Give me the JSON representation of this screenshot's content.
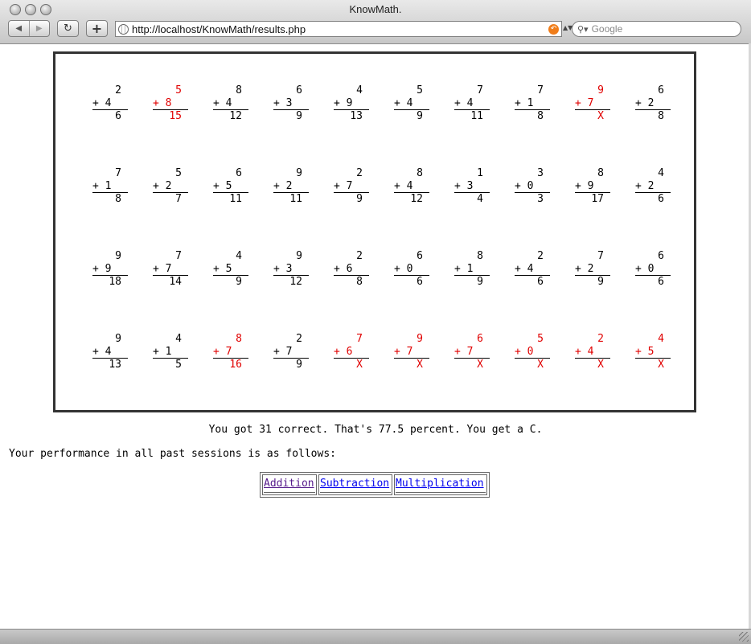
{
  "window": {
    "title": "KnowMath."
  },
  "toolbar": {
    "back_glyph": "◀",
    "forward_glyph": "▶",
    "reload_glyph": "↻",
    "add_glyph": "+",
    "url": "http://localhost/KnowMath/results.php",
    "search_placeholder": "Google",
    "rss_glyph": "↶",
    "dropdown_glyph": "▲▼",
    "search_glyph": "⚲▾"
  },
  "problems": [
    {
      "a": "2",
      "b": "+ 4",
      "ans": "6",
      "wrong": false
    },
    {
      "a": "5",
      "b": "+ 8",
      "ans": "15",
      "wrong": true
    },
    {
      "a": "8",
      "b": "+ 4",
      "ans": "12",
      "wrong": false
    },
    {
      "a": "6",
      "b": "+ 3",
      "ans": "9",
      "wrong": false
    },
    {
      "a": "4",
      "b": "+ 9",
      "ans": "13",
      "wrong": false
    },
    {
      "a": "5",
      "b": "+ 4",
      "ans": "9",
      "wrong": false
    },
    {
      "a": "7",
      "b": "+ 4",
      "ans": "11",
      "wrong": false
    },
    {
      "a": "7",
      "b": "+ 1",
      "ans": "8",
      "wrong": false
    },
    {
      "a": "9",
      "b": "+ 7",
      "ans": "X",
      "wrong": true
    },
    {
      "a": "6",
      "b": "+ 2",
      "ans": "8",
      "wrong": false
    },
    {
      "a": "7",
      "b": "+ 1",
      "ans": "8",
      "wrong": false
    },
    {
      "a": "5",
      "b": "+ 2",
      "ans": "7",
      "wrong": false
    },
    {
      "a": "6",
      "b": "+ 5",
      "ans": "11",
      "wrong": false
    },
    {
      "a": "9",
      "b": "+ 2",
      "ans": "11",
      "wrong": false
    },
    {
      "a": "2",
      "b": "+ 7",
      "ans": "9",
      "wrong": false
    },
    {
      "a": "8",
      "b": "+ 4",
      "ans": "12",
      "wrong": false
    },
    {
      "a": "1",
      "b": "+ 3",
      "ans": "4",
      "wrong": false
    },
    {
      "a": "3",
      "b": "+ 0",
      "ans": "3",
      "wrong": false
    },
    {
      "a": "8",
      "b": "+ 9",
      "ans": "17",
      "wrong": false
    },
    {
      "a": "4",
      "b": "+ 2",
      "ans": "6",
      "wrong": false
    },
    {
      "a": "9",
      "b": "+ 9",
      "ans": "18",
      "wrong": false
    },
    {
      "a": "7",
      "b": "+ 7",
      "ans": "14",
      "wrong": false
    },
    {
      "a": "4",
      "b": "+ 5",
      "ans": "9",
      "wrong": false
    },
    {
      "a": "9",
      "b": "+ 3",
      "ans": "12",
      "wrong": false
    },
    {
      "a": "2",
      "b": "+ 6",
      "ans": "8",
      "wrong": false
    },
    {
      "a": "6",
      "b": "+ 0",
      "ans": "6",
      "wrong": false
    },
    {
      "a": "8",
      "b": "+ 1",
      "ans": "9",
      "wrong": false
    },
    {
      "a": "2",
      "b": "+ 4",
      "ans": "6",
      "wrong": false
    },
    {
      "a": "7",
      "b": "+ 2",
      "ans": "9",
      "wrong": false
    },
    {
      "a": "6",
      "b": "+ 0",
      "ans": "6",
      "wrong": false
    },
    {
      "a": "9",
      "b": "+ 4",
      "ans": "13",
      "wrong": false
    },
    {
      "a": "4",
      "b": "+ 1",
      "ans": "5",
      "wrong": false
    },
    {
      "a": "8",
      "b": "+ 7",
      "ans": "16",
      "wrong": true
    },
    {
      "a": "2",
      "b": "+ 7",
      "ans": "9",
      "wrong": false
    },
    {
      "a": "7",
      "b": "+ 6",
      "ans": "X",
      "wrong": true
    },
    {
      "a": "9",
      "b": "+ 7",
      "ans": "X",
      "wrong": true
    },
    {
      "a": "6",
      "b": "+ 7",
      "ans": "X",
      "wrong": true
    },
    {
      "a": "5",
      "b": "+ 0",
      "ans": "X",
      "wrong": true
    },
    {
      "a": "2",
      "b": "+ 4",
      "ans": "X",
      "wrong": true
    },
    {
      "a": "4",
      "b": "+ 5",
      "ans": "X",
      "wrong": true
    }
  ],
  "result": {
    "text": "You got 31 correct. That's 77.5 percent. You get a C."
  },
  "performance": {
    "text": "Your performance in all past sessions is as follows:"
  },
  "links": [
    {
      "label": "Addition",
      "visited": true
    },
    {
      "label": "Subtraction",
      "visited": false
    },
    {
      "label": "Multiplication",
      "visited": false
    }
  ],
  "colors": {
    "wrong": "#e00000",
    "link": "#0000ee",
    "visited": "#551a8b"
  }
}
